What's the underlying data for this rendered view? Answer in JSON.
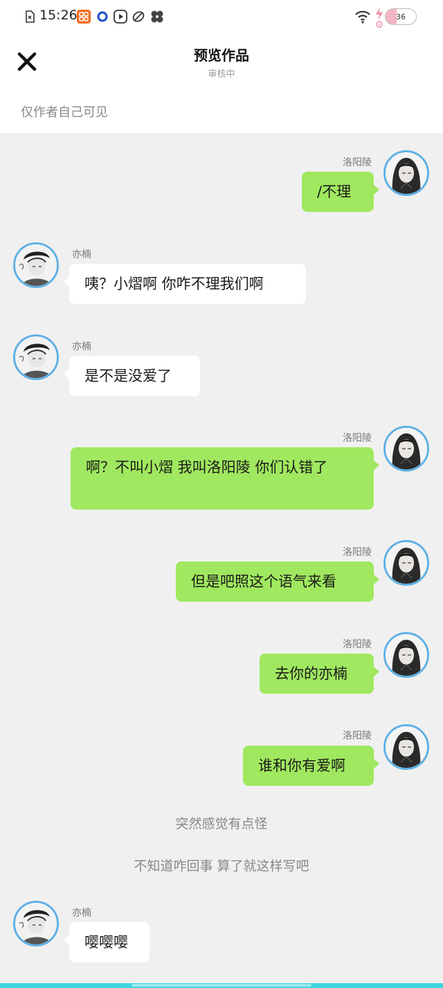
{
  "status_bar": {
    "time": "15:26",
    "battery_level": "36",
    "icons": [
      "sim-card-icon",
      "app-grid-icon",
      "sync-icon",
      "play-icon",
      "link-icon",
      "pinwheel-icon",
      "wifi-icon",
      "charging-icon"
    ]
  },
  "header": {
    "close_icon": "close-icon",
    "title": "预览作品",
    "subtitle": "审核中",
    "visibility_note": "仅作者自己可见"
  },
  "colors": {
    "my_bubble": "#a0e85f",
    "other_bubble": "#ffffff",
    "avatar_ring": "#5fb0e6",
    "background": "#f0f0f0"
  },
  "messages": [
    {
      "type": "bubble",
      "side": "right",
      "name": "洛阳陵",
      "text": "/不理"
    },
    {
      "type": "bubble",
      "side": "left",
      "name": "亦楠",
      "text": "咦？小熠啊 你咋不理我们啊"
    },
    {
      "type": "bubble",
      "side": "left",
      "name": "亦楠",
      "text": "是不是没爱了"
    },
    {
      "type": "bubble",
      "side": "right",
      "name": "洛阳陵",
      "text": "啊？不叫小熠 我叫洛阳陵 你们认错了"
    },
    {
      "type": "bubble",
      "side": "right",
      "name": "洛阳陵",
      "text": "但是吧照这个语气来看"
    },
    {
      "type": "bubble",
      "side": "right",
      "name": "洛阳陵",
      "text": "去你的亦楠"
    },
    {
      "type": "bubble",
      "side": "right",
      "name": "洛阳陵",
      "text": "谁和你有爱啊"
    },
    {
      "type": "narration",
      "text": "突然感觉有点怪"
    },
    {
      "type": "narration",
      "text": "不知道咋回事 算了就这样写吧"
    },
    {
      "type": "bubble",
      "side": "left",
      "name": "亦楠",
      "text": "嘤嘤嘤"
    }
  ]
}
